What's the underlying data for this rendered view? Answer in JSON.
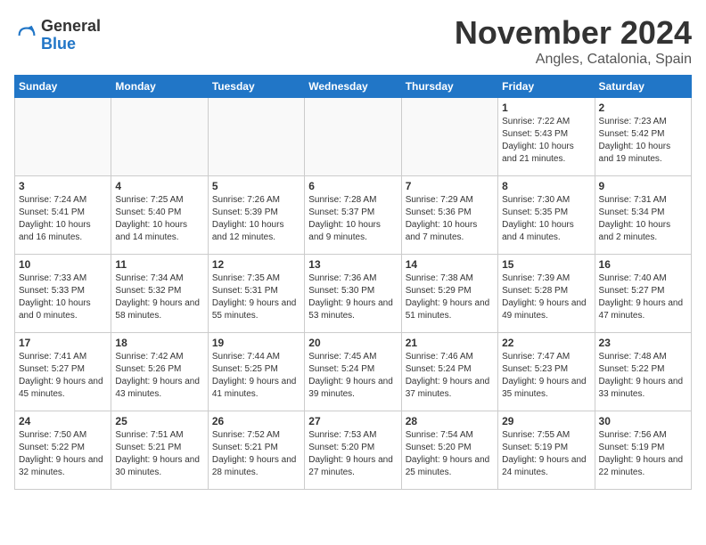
{
  "logo": {
    "general": "General",
    "blue": "Blue"
  },
  "title": "November 2024",
  "location": "Angles, Catalonia, Spain",
  "weekdays": [
    "Sunday",
    "Monday",
    "Tuesday",
    "Wednesday",
    "Thursday",
    "Friday",
    "Saturday"
  ],
  "weeks": [
    [
      {
        "day": "",
        "info": ""
      },
      {
        "day": "",
        "info": ""
      },
      {
        "day": "",
        "info": ""
      },
      {
        "day": "",
        "info": ""
      },
      {
        "day": "",
        "info": ""
      },
      {
        "day": "1",
        "info": "Sunrise: 7:22 AM\nSunset: 5:43 PM\nDaylight: 10 hours and 21 minutes."
      },
      {
        "day": "2",
        "info": "Sunrise: 7:23 AM\nSunset: 5:42 PM\nDaylight: 10 hours and 19 minutes."
      }
    ],
    [
      {
        "day": "3",
        "info": "Sunrise: 7:24 AM\nSunset: 5:41 PM\nDaylight: 10 hours and 16 minutes."
      },
      {
        "day": "4",
        "info": "Sunrise: 7:25 AM\nSunset: 5:40 PM\nDaylight: 10 hours and 14 minutes."
      },
      {
        "day": "5",
        "info": "Sunrise: 7:26 AM\nSunset: 5:39 PM\nDaylight: 10 hours and 12 minutes."
      },
      {
        "day": "6",
        "info": "Sunrise: 7:28 AM\nSunset: 5:37 PM\nDaylight: 10 hours and 9 minutes."
      },
      {
        "day": "7",
        "info": "Sunrise: 7:29 AM\nSunset: 5:36 PM\nDaylight: 10 hours and 7 minutes."
      },
      {
        "day": "8",
        "info": "Sunrise: 7:30 AM\nSunset: 5:35 PM\nDaylight: 10 hours and 4 minutes."
      },
      {
        "day": "9",
        "info": "Sunrise: 7:31 AM\nSunset: 5:34 PM\nDaylight: 10 hours and 2 minutes."
      }
    ],
    [
      {
        "day": "10",
        "info": "Sunrise: 7:33 AM\nSunset: 5:33 PM\nDaylight: 10 hours and 0 minutes."
      },
      {
        "day": "11",
        "info": "Sunrise: 7:34 AM\nSunset: 5:32 PM\nDaylight: 9 hours and 58 minutes."
      },
      {
        "day": "12",
        "info": "Sunrise: 7:35 AM\nSunset: 5:31 PM\nDaylight: 9 hours and 55 minutes."
      },
      {
        "day": "13",
        "info": "Sunrise: 7:36 AM\nSunset: 5:30 PM\nDaylight: 9 hours and 53 minutes."
      },
      {
        "day": "14",
        "info": "Sunrise: 7:38 AM\nSunset: 5:29 PM\nDaylight: 9 hours and 51 minutes."
      },
      {
        "day": "15",
        "info": "Sunrise: 7:39 AM\nSunset: 5:28 PM\nDaylight: 9 hours and 49 minutes."
      },
      {
        "day": "16",
        "info": "Sunrise: 7:40 AM\nSunset: 5:27 PM\nDaylight: 9 hours and 47 minutes."
      }
    ],
    [
      {
        "day": "17",
        "info": "Sunrise: 7:41 AM\nSunset: 5:27 PM\nDaylight: 9 hours and 45 minutes."
      },
      {
        "day": "18",
        "info": "Sunrise: 7:42 AM\nSunset: 5:26 PM\nDaylight: 9 hours and 43 minutes."
      },
      {
        "day": "19",
        "info": "Sunrise: 7:44 AM\nSunset: 5:25 PM\nDaylight: 9 hours and 41 minutes."
      },
      {
        "day": "20",
        "info": "Sunrise: 7:45 AM\nSunset: 5:24 PM\nDaylight: 9 hours and 39 minutes."
      },
      {
        "day": "21",
        "info": "Sunrise: 7:46 AM\nSunset: 5:24 PM\nDaylight: 9 hours and 37 minutes."
      },
      {
        "day": "22",
        "info": "Sunrise: 7:47 AM\nSunset: 5:23 PM\nDaylight: 9 hours and 35 minutes."
      },
      {
        "day": "23",
        "info": "Sunrise: 7:48 AM\nSunset: 5:22 PM\nDaylight: 9 hours and 33 minutes."
      }
    ],
    [
      {
        "day": "24",
        "info": "Sunrise: 7:50 AM\nSunset: 5:22 PM\nDaylight: 9 hours and 32 minutes."
      },
      {
        "day": "25",
        "info": "Sunrise: 7:51 AM\nSunset: 5:21 PM\nDaylight: 9 hours and 30 minutes."
      },
      {
        "day": "26",
        "info": "Sunrise: 7:52 AM\nSunset: 5:21 PM\nDaylight: 9 hours and 28 minutes."
      },
      {
        "day": "27",
        "info": "Sunrise: 7:53 AM\nSunset: 5:20 PM\nDaylight: 9 hours and 27 minutes."
      },
      {
        "day": "28",
        "info": "Sunrise: 7:54 AM\nSunset: 5:20 PM\nDaylight: 9 hours and 25 minutes."
      },
      {
        "day": "29",
        "info": "Sunrise: 7:55 AM\nSunset: 5:19 PM\nDaylight: 9 hours and 24 minutes."
      },
      {
        "day": "30",
        "info": "Sunrise: 7:56 AM\nSunset: 5:19 PM\nDaylight: 9 hours and 22 minutes."
      }
    ]
  ]
}
